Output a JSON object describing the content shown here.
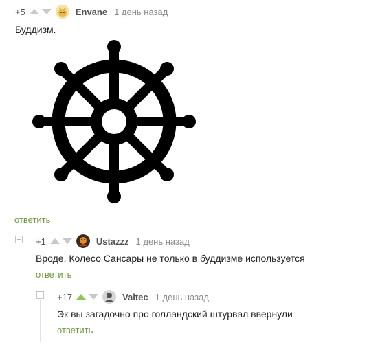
{
  "comments": [
    {
      "rating": "+5",
      "username": "Envane",
      "time": "1 день назад",
      "text": "Буддизм.",
      "reply": "ответить",
      "avatar": "cat-avatar-icon",
      "image": "dharma-wheel-icon"
    },
    {
      "rating": "+1",
      "username": "Ustazzz",
      "time": "1 день назад",
      "text": "Вроде, Колесо Сансары не только в буддизме используется",
      "reply": "ответить",
      "avatar": "character-avatar-icon"
    },
    {
      "rating": "+17",
      "username": "Valtec",
      "time": "1 день назад",
      "text": "Эк вы загадочно про голландский штурвал ввернули",
      "reply": "ответить",
      "avatar": "person-avatar-icon",
      "upvoted": true
    }
  ],
  "colors": {
    "reply_link": "#6f9a3f",
    "upvote_active": "#8ac858",
    "arrow_inactive": "#c9c9c9"
  }
}
